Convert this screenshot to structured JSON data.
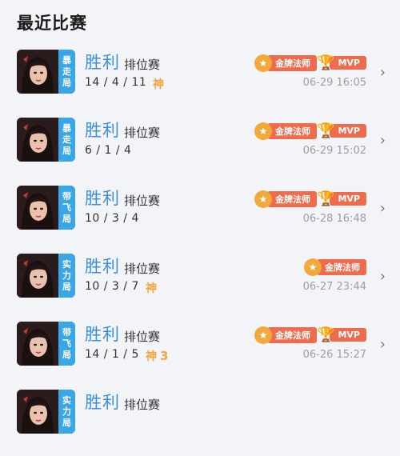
{
  "page_title": "最近比赛",
  "matches": [
    {
      "mode": [
        "暴",
        "走",
        "局"
      ],
      "result": "胜利",
      "type": "排位赛",
      "kda": "14 / 4 / 11",
      "god": "神",
      "god_count": "",
      "badges": [
        {
          "kind": "gold",
          "label": "金牌法师"
        },
        {
          "kind": "mvp",
          "label": "MVP"
        }
      ],
      "time": "06-29 16:05"
    },
    {
      "mode": [
        "暴",
        "走",
        "局"
      ],
      "result": "胜利",
      "type": "排位赛",
      "kda": "6 / 1 / 4",
      "god": "",
      "god_count": "",
      "badges": [
        {
          "kind": "gold",
          "label": "金牌法师"
        },
        {
          "kind": "mvp",
          "label": "MVP"
        }
      ],
      "time": "06-29 15:02"
    },
    {
      "mode": [
        "带",
        "飞",
        "局"
      ],
      "result": "胜利",
      "type": "排位赛",
      "kda": "10 / 3 / 4",
      "god": "",
      "god_count": "",
      "badges": [
        {
          "kind": "gold",
          "label": "金牌法师"
        },
        {
          "kind": "mvp",
          "label": "MVP"
        }
      ],
      "time": "06-28 16:48"
    },
    {
      "mode": [
        "实",
        "力",
        "局"
      ],
      "result": "胜利",
      "type": "排位赛",
      "kda": "10 / 3 / 7",
      "god": "神",
      "god_count": "",
      "badges": [
        {
          "kind": "gold",
          "label": "金牌法师"
        }
      ],
      "time": "06-27 23:44"
    },
    {
      "mode": [
        "带",
        "飞",
        "局"
      ],
      "result": "胜利",
      "type": "排位赛",
      "kda": "14 / 1 / 5",
      "god": "神",
      "god_count": "3",
      "badges": [
        {
          "kind": "gold",
          "label": "金牌法师"
        },
        {
          "kind": "mvp",
          "label": "MVP"
        }
      ],
      "time": "06-26 15:27"
    },
    {
      "mode": [
        "实",
        "力",
        "局"
      ],
      "result": "胜利",
      "type": "排位赛",
      "kda": "",
      "god": "",
      "god_count": "",
      "badges": [],
      "time": ""
    }
  ],
  "colors": {
    "result": "#3b8fe0",
    "mode_tag": "#39a6e8",
    "badge_gold": "#f2a93b",
    "badge_red": "#ef6b4c"
  }
}
